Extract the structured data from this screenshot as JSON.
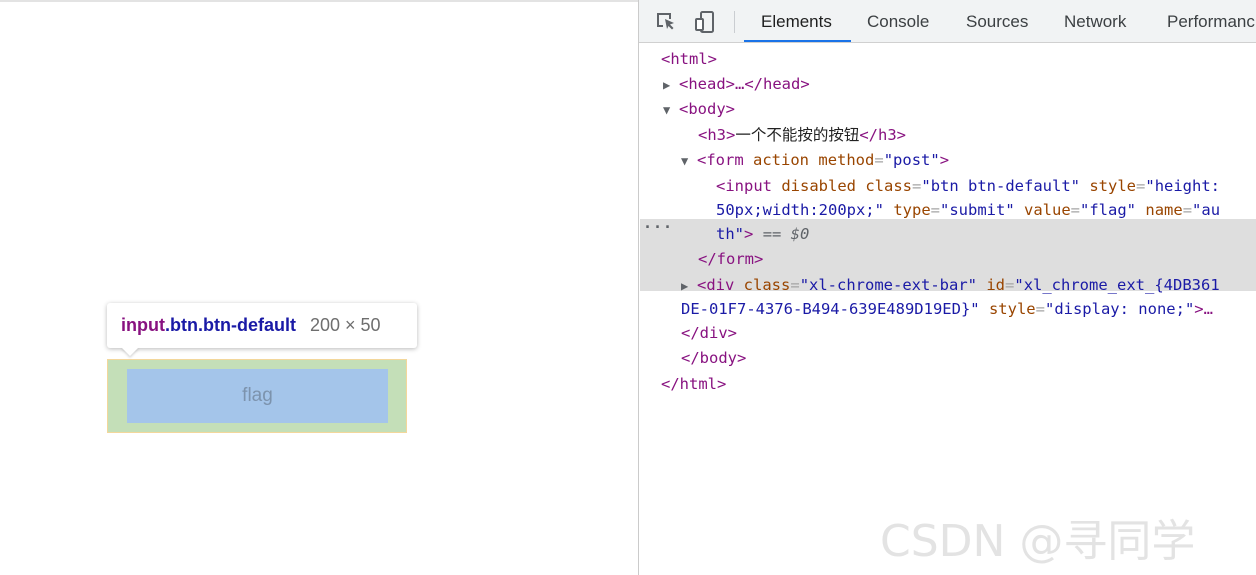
{
  "page": {
    "tooltip": {
      "tag": "input",
      "classes": ".btn.btn-default",
      "size": "200 × 50"
    },
    "button": {
      "value": "flag"
    }
  },
  "devtools": {
    "toolbar": {
      "inspect_icon": "element-picker-icon",
      "device_icon": "device-toolbar-icon",
      "tabs": [
        "Elements",
        "Console",
        "Sources",
        "Network",
        "Performanc"
      ],
      "active_tab": "Elements"
    },
    "dom": {
      "html_open": "<html>",
      "head": "<head>…</head>",
      "body_open": "<body>",
      "h3_open": "<h3>",
      "h3_text": "一个不能按的按钮",
      "h3_close": "</h3>",
      "form_tag": "<form",
      "form_attr_action": "action",
      "form_attr_method": "method",
      "form_method_value": "\"post\"",
      "input_tag": "<input",
      "input_disabled": "disabled",
      "input_class_attr": "class",
      "input_class_value": "\"btn btn-default\"",
      "input_style_attr": "style",
      "input_style_value_1": "\"height:",
      "input_style_value_2": "50px;width:200px;\"",
      "input_type_attr": "type",
      "input_type_value": "\"submit\"",
      "input_value_attr": "value",
      "input_value_value": "\"flag\"",
      "input_name_attr": "name",
      "input_name_value_1": "\"au",
      "input_name_value_2": "th\"",
      "eq_selected": "== $0",
      "form_close": "</form>",
      "div_tag": "<div",
      "div_class_attr": "class",
      "div_class_value": "\"xl-chrome-ext-bar\"",
      "div_id_attr": "id",
      "div_id_value_1": "\"xl_chrome_ext_{4DB361",
      "div_id_value_2": "DE-01F7-4376-B494-639E489D19ED}\"",
      "div_style_attr": "style",
      "div_style_value": "\"display: none;\"",
      "div_ellipsis": ">…",
      "div_close": "</div>",
      "body_close": "</body>",
      "html_close": "</html>"
    }
  },
  "watermark": "CSDN @寻同学"
}
